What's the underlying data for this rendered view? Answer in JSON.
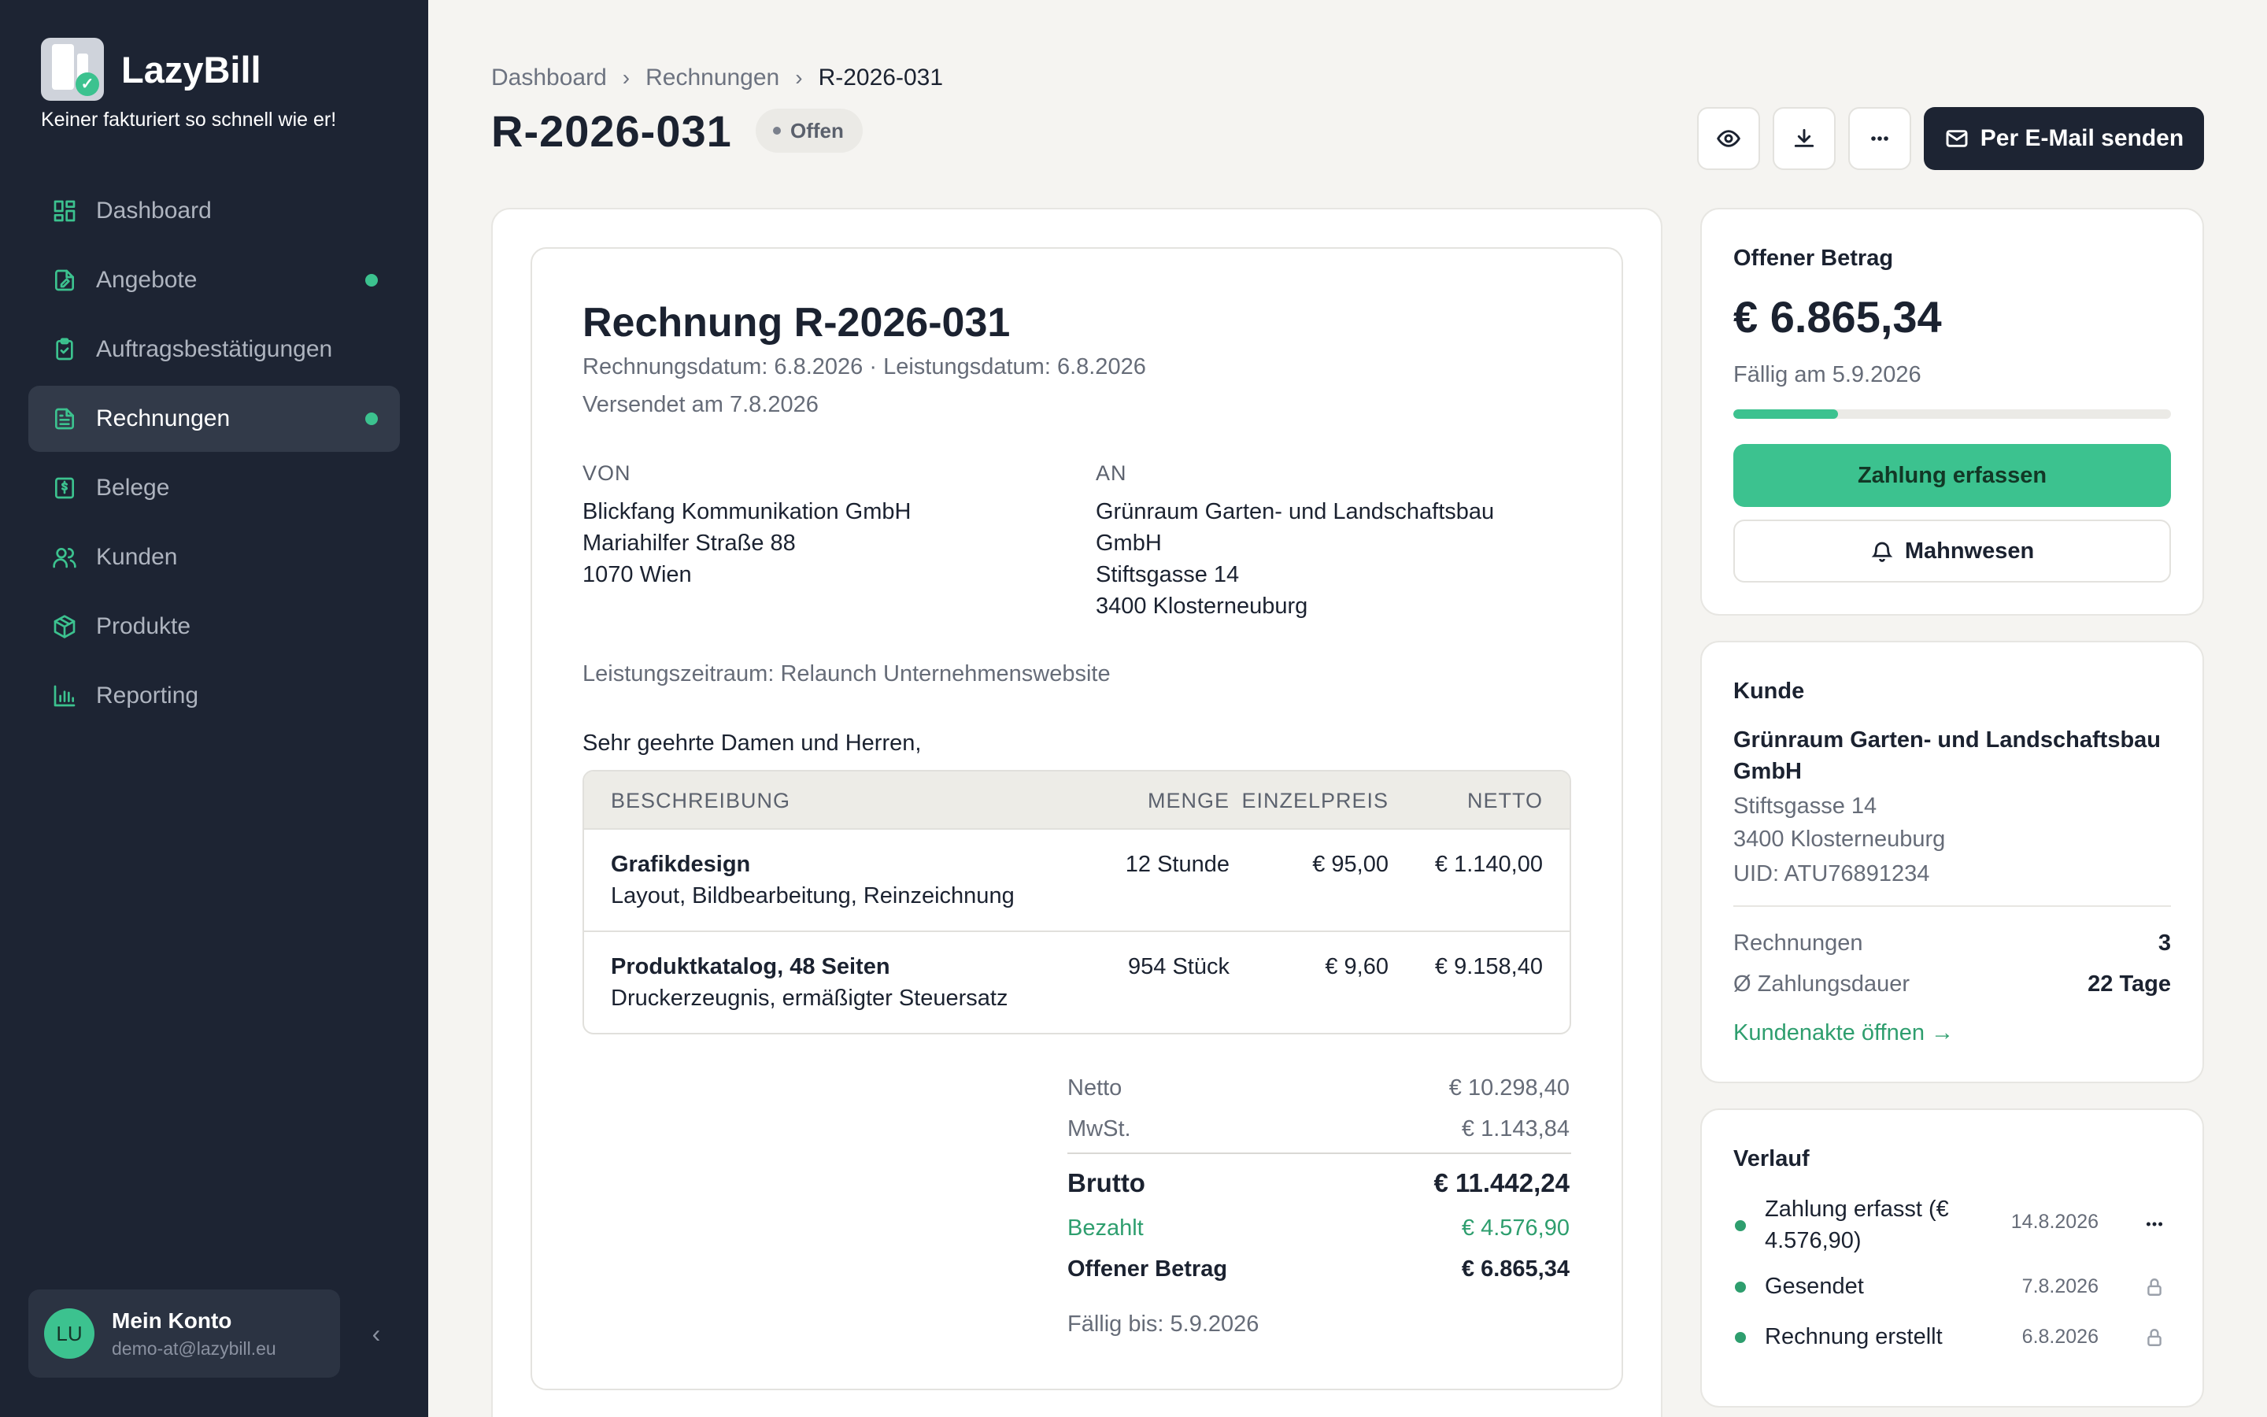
{
  "app": {
    "name": "LazyBill",
    "tagline": "Keiner fakturiert so schnell wie er!"
  },
  "sidebar": {
    "items": [
      {
        "label": "Dashboard",
        "icon": "dashboard-icon",
        "active": false,
        "dot": false
      },
      {
        "label": "Angebote",
        "icon": "offer-icon",
        "active": false,
        "dot": true
      },
      {
        "label": "Auftragsbestätigungen",
        "icon": "clipboard-check-icon",
        "active": false,
        "dot": false
      },
      {
        "label": "Rechnungen",
        "icon": "invoice-icon",
        "active": true,
        "dot": true
      },
      {
        "label": "Belege",
        "icon": "receipt-icon",
        "active": false,
        "dot": false
      },
      {
        "label": "Kunden",
        "icon": "users-icon",
        "active": false,
        "dot": false
      },
      {
        "label": "Produkte",
        "icon": "package-icon",
        "active": false,
        "dot": false
      },
      {
        "label": "Reporting",
        "icon": "bar-chart-icon",
        "active": false,
        "dot": false
      }
    ],
    "account": {
      "initials": "LU",
      "name": "Mein Konto",
      "email": "demo-at@lazybill.eu"
    },
    "collapse_glyph": "‹"
  },
  "header": {
    "breadcrumb": [
      "Dashboard",
      "Rechnungen",
      "R-2026-031"
    ],
    "breadcrumb_sep": "›",
    "title": "R-2026-031",
    "status": "Offen",
    "send_label": "Per E-Mail senden"
  },
  "invoice": {
    "title": "Rechnung R-2026-031",
    "meta_line1": "Rechnungsdatum: 6.8.2026 · Leistungsdatum: 6.8.2026",
    "meta_line2": "Versendet am 7.8.2026",
    "from_label": "VON",
    "from": [
      "Blickfang Kommunikation GmbH",
      "Mariahilfer Straße 88",
      "1070 Wien"
    ],
    "to_label": "AN",
    "to": [
      "Grünraum Garten- und Landschaftsbau",
      "GmbH",
      "Stiftsgasse 14",
      "3400 Klosterneuburg"
    ],
    "period": "Leistungszeitraum: Relaunch Unternehmenswebsite",
    "greeting": "Sehr geehrte Damen und Herren,",
    "columns": [
      "BESCHREIBUNG",
      "MENGE",
      "EINZELPREIS",
      "NETTO"
    ],
    "items": [
      {
        "title": "Grafikdesign",
        "desc": "Layout, Bildbearbeitung, Reinzeichnung",
        "qty": "12 Stunde",
        "unit_price": "€ 95,00",
        "net": "€ 1.140,00"
      },
      {
        "title": "Produktkatalog, 48 Seiten",
        "desc": "Druckerzeugnis, ermäßigter Steuersatz",
        "qty": "954 Stück",
        "unit_price": "€ 9,60",
        "net": "€ 9.158,40"
      }
    ],
    "totals": {
      "net_label": "Netto",
      "net": "€ 10.298,40",
      "vat_label": "MwSt.",
      "vat": "€ 1.143,84",
      "gross_label": "Brutto",
      "gross": "€ 11.442,24",
      "paid_label": "Bezahlt",
      "paid": "€ 4.576,90",
      "open_label": "Offener Betrag",
      "open": "€ 6.865,34",
      "due": "Fällig bis: 5.9.2026"
    }
  },
  "open_card": {
    "title": "Offener Betrag",
    "amount": "€ 6.865,34",
    "due": "Fällig am 5.9.2026",
    "paid_fraction": 0.24,
    "pay_label": "Zahlung erfassen",
    "dunning_label": "Mahnwesen"
  },
  "customer_card": {
    "title": "Kunde",
    "name": "Grünraum Garten- und Landschaftsbau GmbH",
    "street": "Stiftsgasse 14",
    "city": "3400 Klosterneuburg",
    "uid": "UID: ATU76891234",
    "invoices_label": "Rechnungen",
    "invoices_count": "3",
    "pay_duration_label": "Ø Zahlungsdauer",
    "pay_duration": "22 Tage",
    "link_label": "Kundenakte öffnen →"
  },
  "history_card": {
    "title": "Verlauf",
    "entries": [
      {
        "text": "Zahlung erfasst (€ 4.576,90)",
        "date": "14.8.2026",
        "icon": "more-icon"
      },
      {
        "text": "Gesendet",
        "date": "7.8.2026",
        "icon": "lock-icon"
      },
      {
        "text": "Rechnung erstellt",
        "date": "6.8.2026",
        "icon": "lock-icon"
      }
    ]
  },
  "colors": {
    "sidebar_bg": "#1d2433",
    "accent_green": "#3cc28f",
    "page_bg": "#f5f4f1"
  }
}
